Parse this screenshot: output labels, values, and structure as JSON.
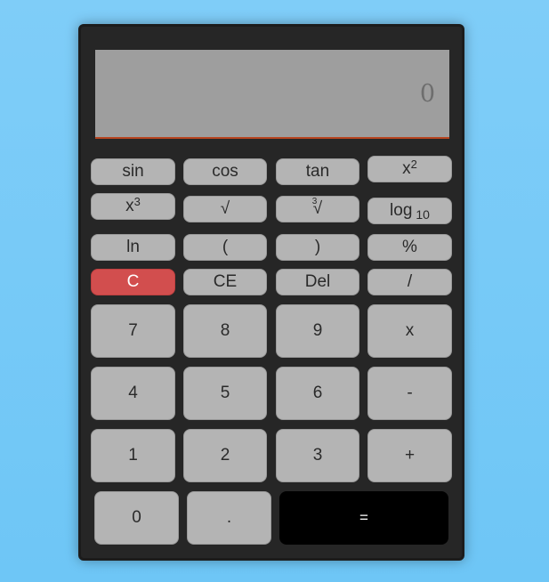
{
  "display": {
    "value": "0"
  },
  "buttons": {
    "sin": "sin",
    "cos": "cos",
    "tan": "tan",
    "square_base": "x",
    "square_exp": "2",
    "cube_base": "x",
    "cube_exp": "3",
    "sqrt": "√",
    "cbrt_index": "3",
    "cbrt_symbol": "√",
    "log_label": "log",
    "log_base": "10",
    "ln": "ln",
    "open_paren": "(",
    "close_paren": ")",
    "percent": "%",
    "clear": "C",
    "clear_entry": "CE",
    "delete": "Del",
    "divide": "/",
    "seven": "7",
    "eight": "8",
    "nine": "9",
    "multiply": "x",
    "four": "4",
    "five": "5",
    "six": "6",
    "subtract": "-",
    "one": "1",
    "two": "2",
    "three": "3",
    "add": "+",
    "zero": "0",
    "decimal": ".",
    "equals": "="
  },
  "colors": {
    "background": "#74c9f7",
    "body": "#262626",
    "display": "#9e9e9e",
    "display_underline": "#b8441f",
    "button": "#b4b4b4",
    "clear_button": "#d24e4e",
    "equals_button": "#000000"
  }
}
